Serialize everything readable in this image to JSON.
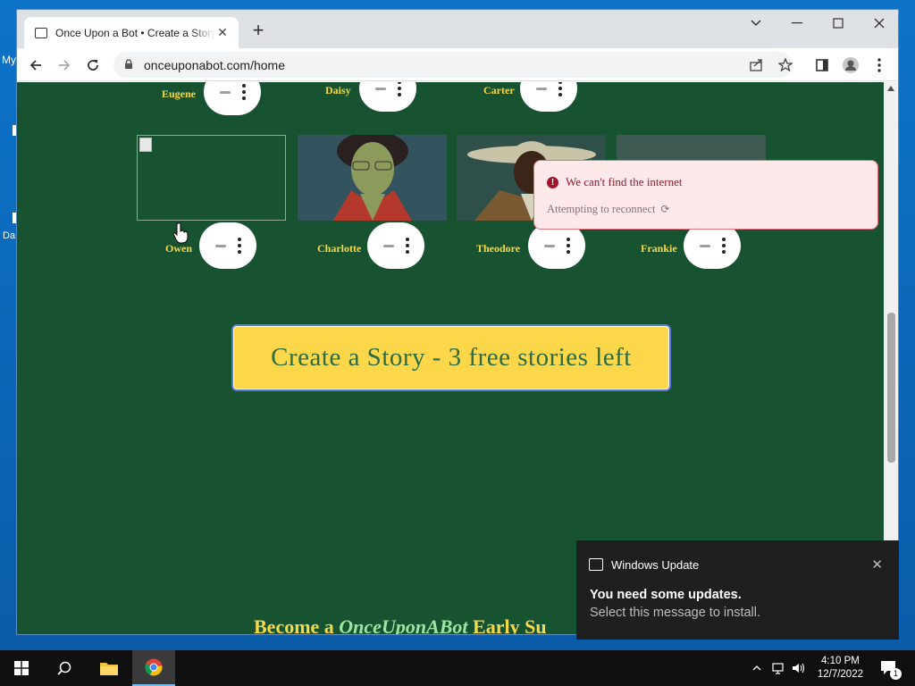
{
  "desktop": {
    "fragments": [
      "My",
      "Da"
    ]
  },
  "browser": {
    "tab_title": "Once Upon a Bot • Create a Story",
    "url": "onceuponabot.com/home"
  },
  "characters_row1": [
    {
      "name": "Eugene"
    },
    {
      "name": "Daisy"
    },
    {
      "name": "Carter"
    }
  ],
  "characters_row2": [
    {
      "name": "Owen"
    },
    {
      "name": "Charlotte"
    },
    {
      "name": "Theodore"
    },
    {
      "name": "Frankie"
    }
  ],
  "cta": {
    "label": "Create a Story - 3 free stories left"
  },
  "early": {
    "prefix": "Become a ",
    "brand": "OnceUponABot",
    "suffix": " Early Su"
  },
  "offline": {
    "title": "We can't find the internet",
    "subtitle": "Attempting to reconnect"
  },
  "toast": {
    "app": "Windows Update",
    "heading": "You need some updates.",
    "body": "Select this message to install."
  },
  "clock": {
    "time": "4:10 PM",
    "date": "12/7/2022"
  },
  "notification_count": "1",
  "colors": {
    "page_bg": "#175231",
    "cta_bg": "#fdd74a",
    "name_text": "#f5d94a"
  }
}
